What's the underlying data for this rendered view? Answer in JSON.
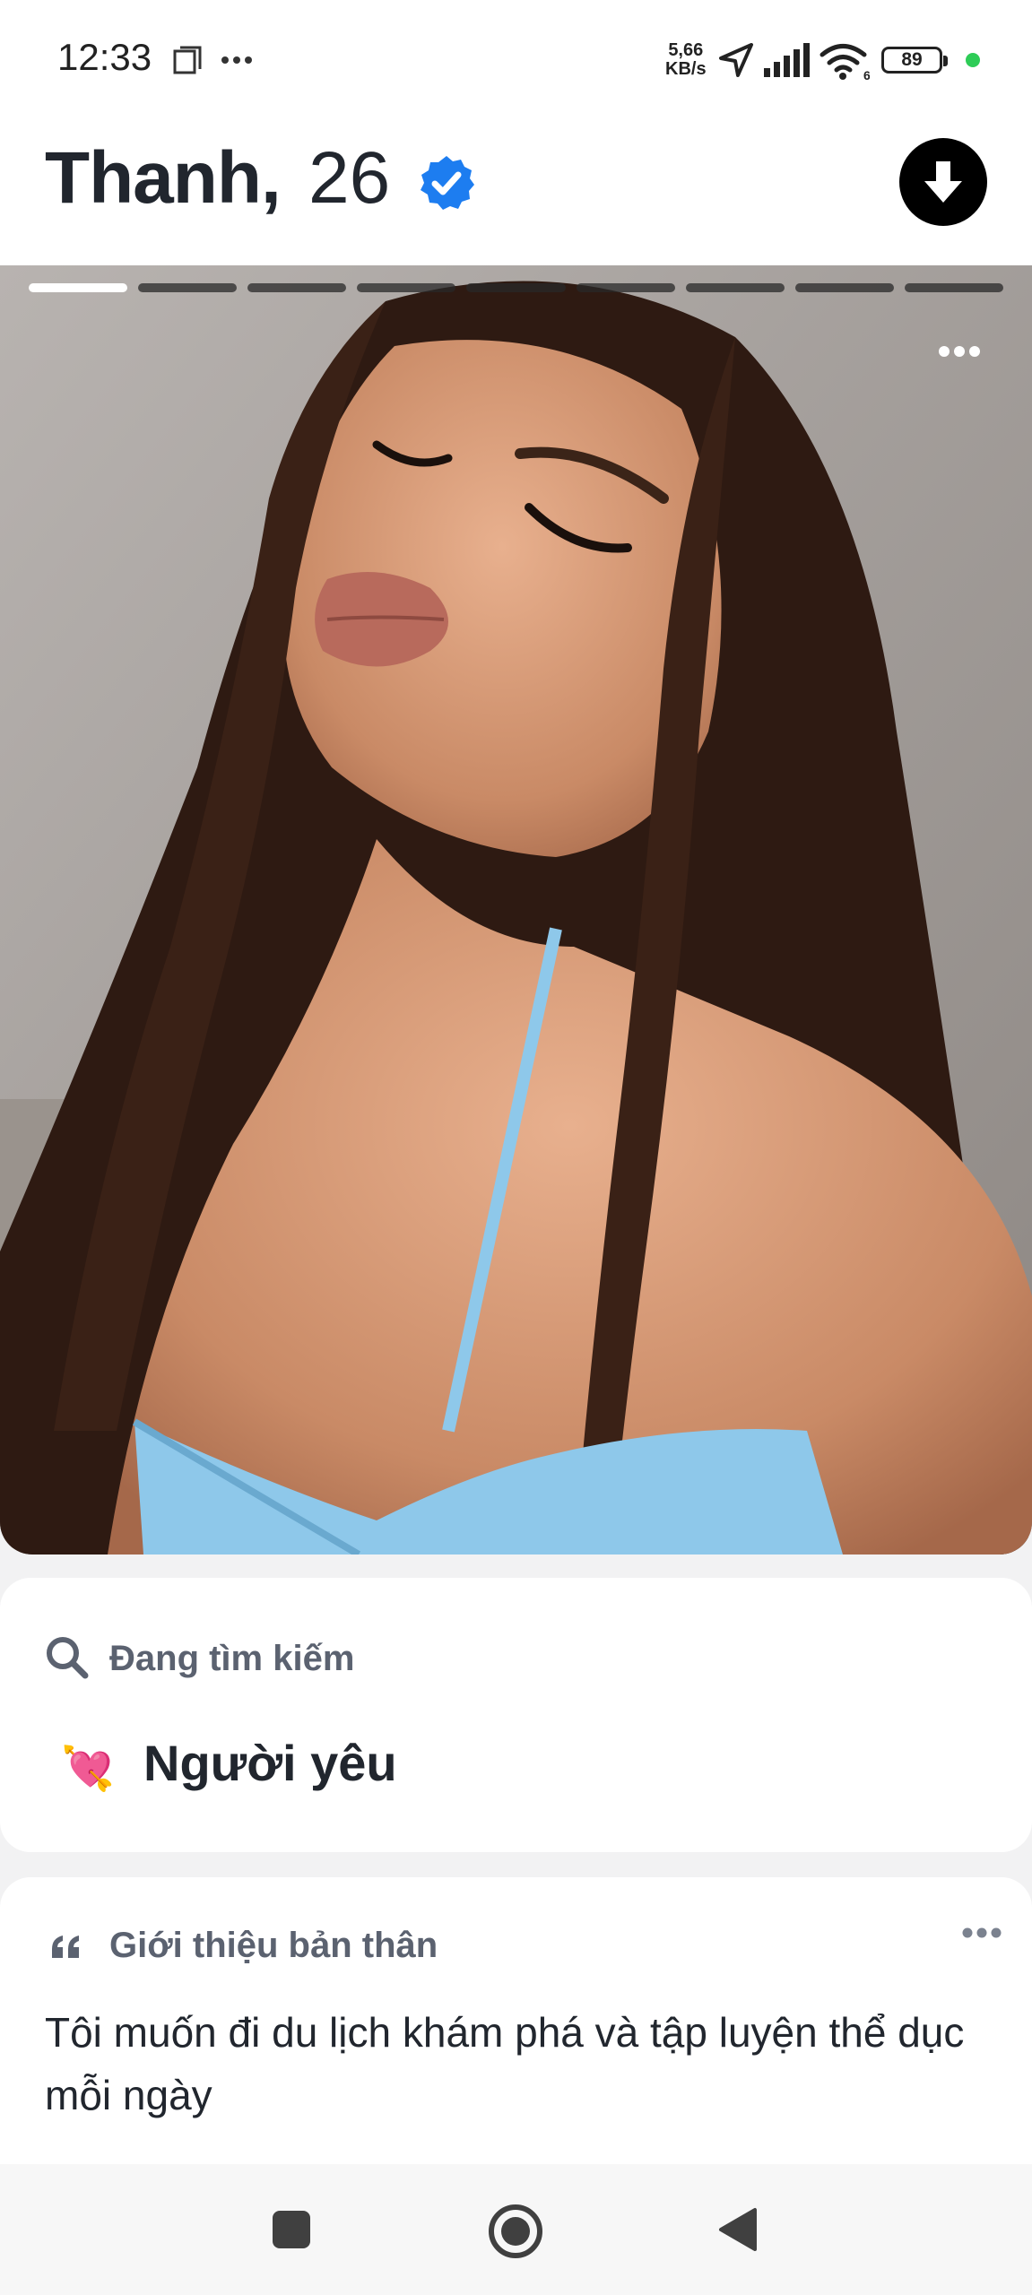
{
  "status_bar": {
    "time": "12:33",
    "net_speed_value": "5,66",
    "net_speed_unit": "KB/s",
    "battery": "89",
    "wifi_badge": "6"
  },
  "profile": {
    "name": "Thanh,",
    "age": "26",
    "verified": true
  },
  "photo": {
    "total_photos": 9,
    "current_photo": 1
  },
  "looking_for": {
    "heading": "Đang tìm kiếm",
    "value": "Người yêu",
    "emoji": "💘"
  },
  "about": {
    "heading": "Giới thiệu bản thân",
    "text": "Tôi muốn đi du lịch khám phá và tập luyện thể dục mỗi ngày"
  },
  "colors": {
    "verified_blue": "#1d7df0",
    "top_dress": "#8ec8ea",
    "hair": "#2e1a12"
  }
}
